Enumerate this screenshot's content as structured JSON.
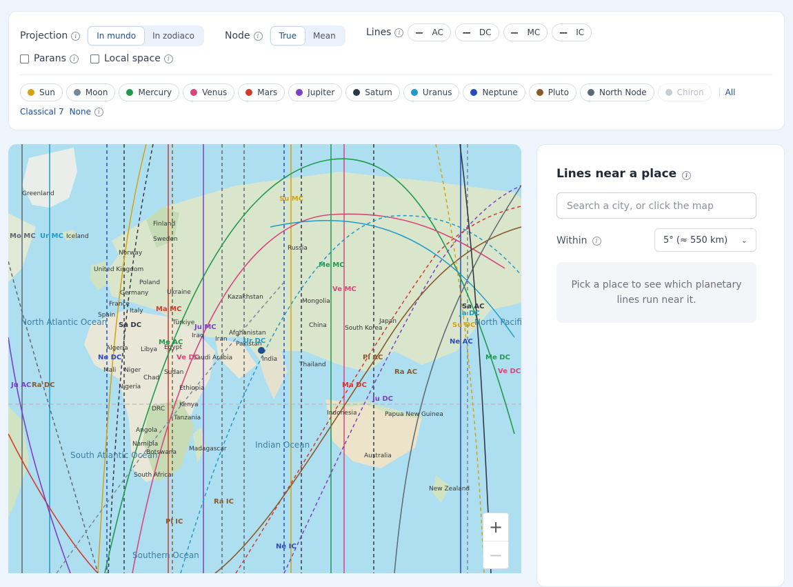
{
  "controls": {
    "projection": {
      "label": "Projection",
      "options": [
        "In mundo",
        "In zodiaco"
      ],
      "selected": "In mundo"
    },
    "node": {
      "label": "Node",
      "options": [
        "True",
        "Mean"
      ],
      "selected": "True"
    },
    "lines": {
      "label": "Lines",
      "items": [
        {
          "glyph": "—",
          "label": "AC"
        },
        {
          "glyph": "---",
          "label": "DC"
        },
        {
          "glyph": "—",
          "label": "MC"
        },
        {
          "glyph": "---",
          "label": "IC"
        }
      ]
    },
    "parans": {
      "label": "Parans",
      "checked": false
    },
    "local_space": {
      "label": "Local space",
      "checked": false
    },
    "planets": [
      {
        "label": "Sun",
        "color": "#d4a20f",
        "active": true
      },
      {
        "label": "Moon",
        "color": "#7b8794",
        "active": true
      },
      {
        "label": "Mercury",
        "color": "#1f9a4c",
        "active": true
      },
      {
        "label": "Venus",
        "color": "#d9457a",
        "active": true
      },
      {
        "label": "Mars",
        "color": "#d33a2c",
        "active": true
      },
      {
        "label": "Jupiter",
        "color": "#7c3fc6",
        "active": true
      },
      {
        "label": "Saturn",
        "color": "#303845",
        "active": true
      },
      {
        "label": "Uranus",
        "color": "#1e9ac8",
        "active": true
      },
      {
        "label": "Neptune",
        "color": "#2b4bbd",
        "active": true
      },
      {
        "label": "Pluto",
        "color": "#8a5a2b",
        "active": true
      },
      {
        "label": "North Node",
        "color": "#5f6773",
        "active": true
      },
      {
        "label": "Chiron",
        "color": "#c8cdd4",
        "active": false
      }
    ],
    "presets": {
      "all": "All",
      "classical": "Classical 7",
      "none": "None"
    }
  },
  "map": {
    "oceans": [
      "North Atlantic Ocean",
      "South Atlantic Ocean",
      "Indian Ocean",
      "Southern Ocean",
      "North Pacific Ocean"
    ],
    "places": [
      "Greenland",
      "Iceland",
      "Finland",
      "Sweden",
      "Norway",
      "United Kingdom",
      "Poland",
      "Germany",
      "France",
      "Ukraine",
      "Italy",
      "Spain",
      "Türkiye",
      "Russia",
      "Kazakhstan",
      "Mongolia",
      "China",
      "South Korea",
      "Japan",
      "Afghanistan",
      "Pakistan",
      "India",
      "Thailand",
      "Iraq",
      "Iran",
      "Saudi Arabia",
      "Egypt",
      "Libya",
      "Algeria",
      "Mali",
      "Niger",
      "Chad",
      "Sudan",
      "Ethiopia",
      "Nigeria",
      "Kenya",
      "DRC",
      "Tanzania",
      "Angola",
      "Namibia",
      "Botswana",
      "South Africa",
      "Madagascar",
      "Indonesia",
      "Papua New Guinea",
      "Australia",
      "New Zealand"
    ],
    "line_labels": [
      "Mo MC",
      "Ur MC",
      "Su MC",
      "Me MC",
      "Ve MC",
      "Ma MC",
      "Ju MC",
      "Sa DC",
      "Me AC",
      "Ve DC",
      "Ne DC",
      "Ju AC",
      "Ra DC",
      "Ur DC",
      "Ju DC",
      "Pl AC",
      "Ra AC",
      "Ma DC",
      "Sa AC",
      "Su DC",
      "Ne AC",
      "Me DC",
      "Ve DC",
      "Ra IC",
      "Pl IC",
      "Ne IC",
      "Ja DC"
    ],
    "zoom_in": "+",
    "zoom_out": "−"
  },
  "side": {
    "title": "Lines near a place",
    "search_placeholder": "Search a city, or click the map",
    "within_label": "Within",
    "within_value": "5° (≈ 550 km)",
    "empty_text_1": "Pick a place to see which planetary",
    "empty_text_2": "lines run near it."
  }
}
